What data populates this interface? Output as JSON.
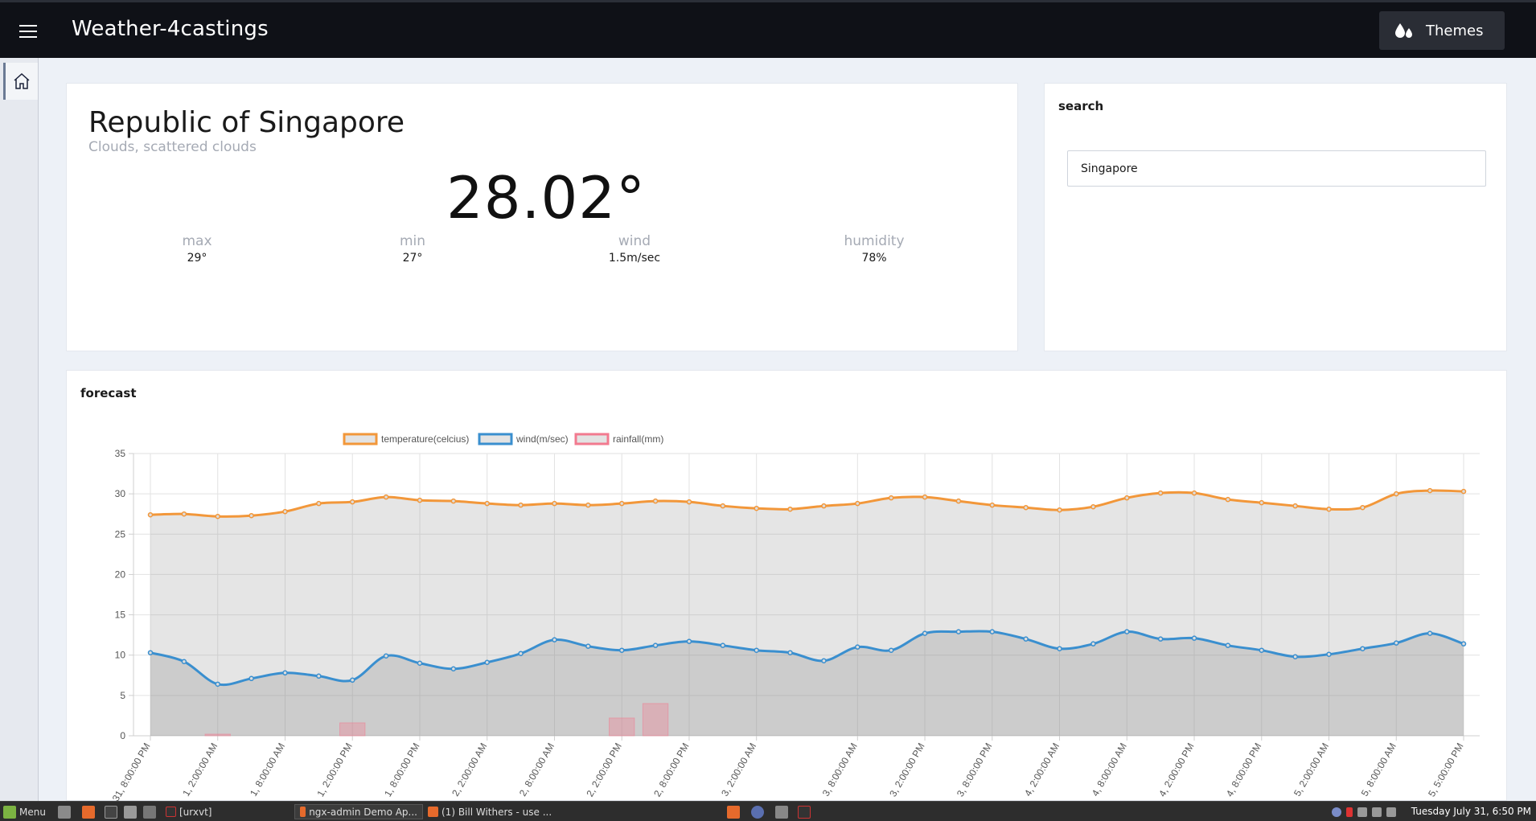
{
  "header": {
    "title": "Weather-4castings",
    "themes_label": "Themes"
  },
  "weather": {
    "city": "Republic of Singapore",
    "description": "Clouds, scattered clouds",
    "temperature": "28.02°",
    "stats": [
      {
        "label": "max",
        "value": "29°"
      },
      {
        "label": "min",
        "value": "27°"
      },
      {
        "label": "wind",
        "value": "1.5m/sec"
      },
      {
        "label": "humidity",
        "value": "78%"
      }
    ]
  },
  "search": {
    "title": "search",
    "value": "Singapore"
  },
  "forecast": {
    "title": "forecast"
  },
  "chart_data": {
    "type": "line",
    "ylim": [
      0,
      35
    ],
    "y_ticks": [
      "0",
      "5",
      "10",
      "15",
      "20",
      "25",
      "30",
      "35"
    ],
    "x_tick_labels": [
      "31, 8:00:00 PM",
      "1, 2:00:00 AM",
      "1, 8:00:00 AM",
      "1, 2:00:00 PM",
      "1, 8:00:00 PM",
      "2, 2:00:00 AM",
      "2, 8:00:00 AM",
      "2, 2:00:00 PM",
      "2, 8:00:00 PM",
      "3, 2:00:00 AM",
      "3, 8:00:00 AM",
      "3, 2:00:00 PM",
      "3, 8:00:00 PM",
      "4, 2:00:00 AM",
      "4, 8:00:00 AM",
      "4, 2:00:00 PM",
      "4, 8:00:00 PM",
      "5, 2:00:00 AM",
      "5, 8:00:00 AM",
      "5, 5:00:00 PM"
    ],
    "grid": true,
    "legend_position": "top",
    "series": [
      {
        "name": "temperature(celcius)",
        "color": "#f2973a",
        "values": [
          27.4,
          27.5,
          27.2,
          27.3,
          27.8,
          28.8,
          29.0,
          29.6,
          29.2,
          29.1,
          28.8,
          28.6,
          28.8,
          28.6,
          28.8,
          29.1,
          29.0,
          28.5,
          28.2,
          28.1,
          28.5,
          28.8,
          29.5,
          29.6,
          29.1,
          28.6,
          28.3,
          28.0,
          28.4,
          29.5,
          30.1,
          30.1,
          29.3,
          28.9,
          28.5,
          28.1,
          28.3,
          30.0,
          30.4,
          30.3
        ]
      },
      {
        "name": "wind(m/sec)",
        "color": "#3a8fcf",
        "values": [
          10.3,
          9.2,
          6.4,
          7.1,
          7.8,
          7.4,
          6.9,
          9.9,
          9.0,
          8.3,
          9.1,
          10.2,
          11.9,
          11.1,
          10.6,
          11.2,
          11.7,
          11.2,
          10.6,
          10.3,
          9.3,
          11.0,
          10.6,
          12.7,
          12.9,
          12.9,
          12.0,
          10.8,
          11.4,
          12.9,
          12.0,
          12.1,
          11.2,
          10.6,
          9.8,
          10.1,
          10.8,
          11.5,
          12.7,
          11.4
        ]
      },
      {
        "name": "rainfall(mm)",
        "color": "#f27a8f",
        "type": "bar",
        "values": [
          0,
          0,
          0.2,
          0,
          0,
          0,
          1.6,
          0,
          0,
          0,
          0,
          0,
          0,
          0,
          2.2,
          4.0,
          0,
          0,
          0,
          0,
          0,
          0,
          0,
          0,
          0,
          0,
          0,
          0,
          0,
          0,
          0,
          0,
          0,
          0,
          0,
          0,
          0,
          0,
          0,
          0
        ]
      }
    ]
  },
  "taskbar": {
    "menu_label": "Menu",
    "windows": [
      "[urxvt]",
      "ngx-admin Demo Ap...",
      "(1) Bill Withers - use ..."
    ],
    "clock": "Tuesday July 31, 6:50 PM"
  }
}
